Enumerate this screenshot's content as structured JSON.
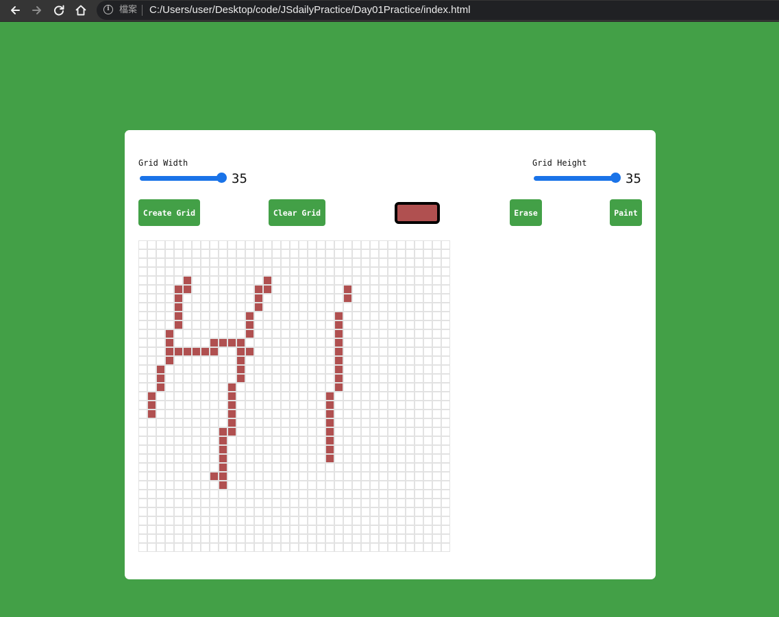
{
  "browser": {
    "back_icon": "arrow-left-icon",
    "forward_icon": "arrow-right-icon",
    "reload_icon": "reload-icon",
    "home_icon": "home-icon",
    "info_icon": "info-icon",
    "info_glyph": "i",
    "file_label": "檔案",
    "url": "C:/Users/user/Desktop/code/JSdailyPractice/Day01Practice/index.html"
  },
  "colors": {
    "page_background": "#43a047",
    "card_background": "#ffffff",
    "button_background": "#43a047",
    "slider_accent": "#1a73e8",
    "paint_color": "#b05050",
    "grid_line": "#e2e2e2"
  },
  "controls": {
    "width": {
      "label": "Grid Width",
      "value": "35"
    },
    "height": {
      "label": "Grid Height",
      "value": "35"
    }
  },
  "buttons": {
    "create": "Create Grid",
    "clear": "Clear Grid",
    "erase": "Erase",
    "paint": "Paint"
  },
  "grid": {
    "columns": 35,
    "rows": 35,
    "painted_cells": [
      [
        4,
        5
      ],
      [
        4,
        14
      ],
      [
        5,
        4
      ],
      [
        5,
        5
      ],
      [
        5,
        13
      ],
      [
        5,
        14
      ],
      [
        5,
        23
      ],
      [
        6,
        4
      ],
      [
        6,
        13
      ],
      [
        6,
        23
      ],
      [
        7,
        4
      ],
      [
        7,
        13
      ],
      [
        8,
        4
      ],
      [
        8,
        12
      ],
      [
        8,
        22
      ],
      [
        9,
        4
      ],
      [
        9,
        12
      ],
      [
        9,
        22
      ],
      [
        10,
        3
      ],
      [
        10,
        12
      ],
      [
        10,
        22
      ],
      [
        11,
        3
      ],
      [
        11,
        8
      ],
      [
        11,
        9
      ],
      [
        11,
        10
      ],
      [
        11,
        11
      ],
      [
        11,
        22
      ],
      [
        12,
        3
      ],
      [
        12,
        4
      ],
      [
        12,
        5
      ],
      [
        12,
        6
      ],
      [
        12,
        7
      ],
      [
        12,
        8
      ],
      [
        12,
        11
      ],
      [
        12,
        12
      ],
      [
        12,
        22
      ],
      [
        13,
        3
      ],
      [
        13,
        11
      ],
      [
        13,
        22
      ],
      [
        14,
        2
      ],
      [
        14,
        11
      ],
      [
        14,
        22
      ],
      [
        15,
        2
      ],
      [
        15,
        11
      ],
      [
        15,
        22
      ],
      [
        16,
        2
      ],
      [
        16,
        10
      ],
      [
        16,
        22
      ],
      [
        17,
        1
      ],
      [
        17,
        10
      ],
      [
        17,
        21
      ],
      [
        18,
        1
      ],
      [
        18,
        10
      ],
      [
        18,
        21
      ],
      [
        19,
        1
      ],
      [
        19,
        10
      ],
      [
        19,
        21
      ],
      [
        20,
        10
      ],
      [
        20,
        21
      ],
      [
        21,
        9
      ],
      [
        21,
        10
      ],
      [
        21,
        21
      ],
      [
        22,
        9
      ],
      [
        22,
        21
      ],
      [
        23,
        9
      ],
      [
        23,
        21
      ],
      [
        24,
        9
      ],
      [
        24,
        21
      ],
      [
        25,
        9
      ],
      [
        26,
        8
      ],
      [
        26,
        9
      ],
      [
        27,
        9
      ]
    ]
  }
}
